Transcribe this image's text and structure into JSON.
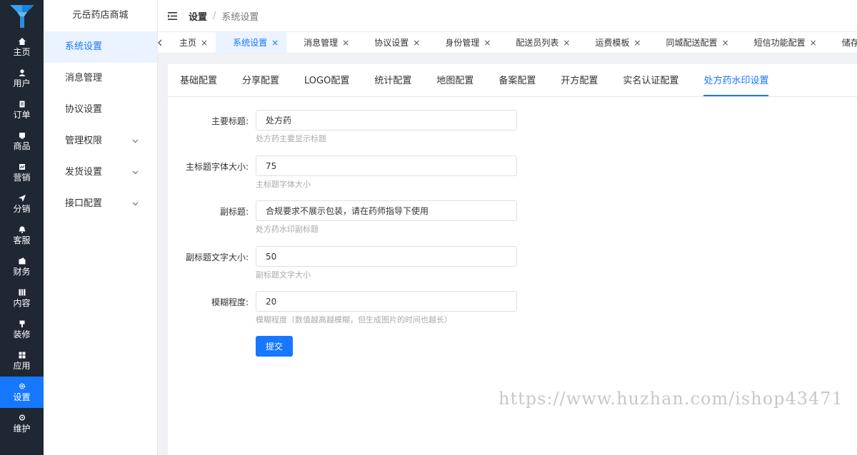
{
  "brand_color": "#1677ff",
  "rail": {
    "logo_icon": "logo-icon",
    "items": [
      {
        "label": "主页",
        "icon": "home-icon"
      },
      {
        "label": "用户",
        "icon": "user-icon"
      },
      {
        "label": "订单",
        "icon": "order-icon"
      },
      {
        "label": "商品",
        "icon": "goods-icon"
      },
      {
        "label": "营销",
        "icon": "marketing-icon"
      },
      {
        "label": "分销",
        "icon": "send-icon"
      },
      {
        "label": "客服",
        "icon": "bell-icon"
      },
      {
        "label": "财务",
        "icon": "wallet-icon"
      },
      {
        "label": "内容",
        "icon": "content-icon"
      },
      {
        "label": "装修",
        "icon": "brush-icon"
      },
      {
        "label": "应用",
        "icon": "apps-icon"
      },
      {
        "label": "设置",
        "icon": "gear-icon",
        "active": true
      },
      {
        "label": "维护",
        "icon": "maintenance-icon"
      }
    ]
  },
  "sidebar": {
    "title": "元岳药店商城",
    "items": [
      {
        "label": "系统设置",
        "active": true
      },
      {
        "label": "消息管理"
      },
      {
        "label": "协议设置"
      },
      {
        "label": "管理权限",
        "expandable": true
      },
      {
        "label": "发货设置",
        "expandable": true
      },
      {
        "label": "接口配置",
        "expandable": true
      }
    ]
  },
  "header": {
    "breadcrumb_main": "设置",
    "breadcrumb_sep": "/",
    "breadcrumb_sub": "系统设置"
  },
  "tabs": {
    "items": [
      {
        "label": "主页"
      },
      {
        "label": "系统设置",
        "active": true
      },
      {
        "label": "消息管理"
      },
      {
        "label": "协议设置"
      },
      {
        "label": "身份管理"
      },
      {
        "label": "配送员列表"
      },
      {
        "label": "运费模板"
      },
      {
        "label": "同城配送配置"
      },
      {
        "label": "短信功能配置"
      },
      {
        "label": "储存配置"
      }
    ],
    "close_glyph": "×"
  },
  "subtabs": {
    "items": [
      {
        "label": "基础配置"
      },
      {
        "label": "分享配置"
      },
      {
        "label": "LOGO配置"
      },
      {
        "label": "统计配置"
      },
      {
        "label": "地图配置"
      },
      {
        "label": "备案配置"
      },
      {
        "label": "开方配置"
      },
      {
        "label": "实名认证配置"
      },
      {
        "label": "处方药水印设置",
        "active": true
      }
    ]
  },
  "form": {
    "fields": [
      {
        "label": "主要标题:",
        "value": "处方药",
        "help": "处方药主要显示标题"
      },
      {
        "label": "主标题字体大小:",
        "value": "75",
        "help": "主标题字体大小"
      },
      {
        "label": "副标题:",
        "value": "合规要求不展示包装，请在药师指导下使用",
        "help": "处方药水印副标题"
      },
      {
        "label": "副标题文字大小:",
        "value": "50",
        "help": "副标题文字大小"
      },
      {
        "label": "模糊程度:",
        "value": "20",
        "help": "模糊程度（数值越高越模糊，但生成图片的时间也越长）"
      }
    ],
    "submit_label": "提交"
  },
  "watermark": "https://www.huzhan.com/ishop43471"
}
